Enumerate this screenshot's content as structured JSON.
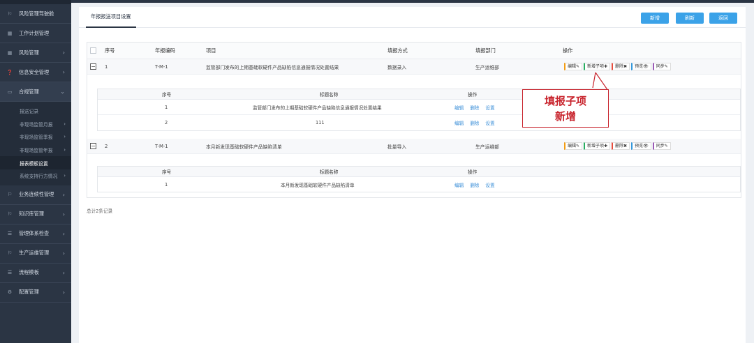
{
  "sidebar": {
    "items": [
      {
        "label": "风险管理驾驶舱",
        "icon": "flag-icon",
        "chev": ""
      },
      {
        "label": "工作计划管理",
        "icon": "calendar-icon",
        "chev": ""
      },
      {
        "label": "风险管理",
        "icon": "calendar-icon",
        "chev": "›"
      },
      {
        "label": "信息安全管理",
        "icon": "question-icon",
        "chev": "›"
      },
      {
        "label": "合规管理",
        "icon": "folder-icon",
        "chev": "⌄"
      }
    ],
    "subitems": [
      {
        "label": "报送记录",
        "chev": ""
      },
      {
        "label": "非现场监管月报",
        "chev": "›"
      },
      {
        "label": "非现场监管季报",
        "chev": "›"
      },
      {
        "label": "非现场监管年报",
        "chev": "›"
      },
      {
        "label": "报表模板设置",
        "chev": ""
      },
      {
        "label": "系统支持行方情况",
        "chev": "›"
      }
    ],
    "items2": [
      {
        "label": "业务连续性管理",
        "icon": "flag-icon",
        "chev": "›"
      },
      {
        "label": "知识库管理",
        "icon": "flag-icon",
        "chev": "›"
      },
      {
        "label": "管理体系检查",
        "icon": "list-icon",
        "chev": "›"
      },
      {
        "label": "生产运维管理",
        "icon": "flag-icon",
        "chev": "›"
      },
      {
        "label": "流程模板",
        "icon": "list-icon",
        "chev": "›"
      },
      {
        "label": "配置管理",
        "icon": "gear-icon",
        "chev": "›"
      }
    ]
  },
  "tab": {
    "label": "年报报送项目设置"
  },
  "toolbar": {
    "add": "新增",
    "refresh": "刷新",
    "back": "返回"
  },
  "table": {
    "headers": {
      "seq": "序号",
      "code": "年报编码",
      "item": "项目",
      "method": "填报方式",
      "dept": "填报部门",
      "ops": "操作"
    },
    "rows": [
      {
        "seq": "1",
        "code": "T-M-1",
        "item": "监管部门发布的上期基础软硬件产品缺陷信息通报情况处置结果",
        "method": "数据录入",
        "dept": "生产运维部"
      },
      {
        "seq": "2",
        "code": "T-M-1",
        "item": "本月新发现基础软硬件产品缺陷清单",
        "method": "批量导入",
        "dept": "生产运维部"
      }
    ],
    "ops": {
      "edit": "编辑✎",
      "add_child": "新增子项✚",
      "del": "删除✖",
      "preview": "预览👁",
      "sync": "同步✎"
    }
  },
  "subtable": {
    "headers": {
      "seq": "序号",
      "title": "标题名称",
      "ops": "操作"
    },
    "links": {
      "edit": "编辑",
      "del": "删除",
      "set": "设置"
    },
    "group1": [
      {
        "seq": "1",
        "title": "监管部门发布的上期基础软硬件产品缺陷信息通报情况处置结果"
      },
      {
        "seq": "2",
        "title": "111"
      }
    ],
    "group2": [
      {
        "seq": "1",
        "title": "本月新发现基础软硬件产品缺陷清单"
      }
    ]
  },
  "footer": {
    "total": "总计2条记录"
  },
  "annotation": {
    "line1": "填报子项",
    "line2": "新增"
  },
  "colors": {
    "sidebar_bg": "#2b3544",
    "button_blue": "#3ba2e8",
    "annotation_red": "#c8232c"
  }
}
